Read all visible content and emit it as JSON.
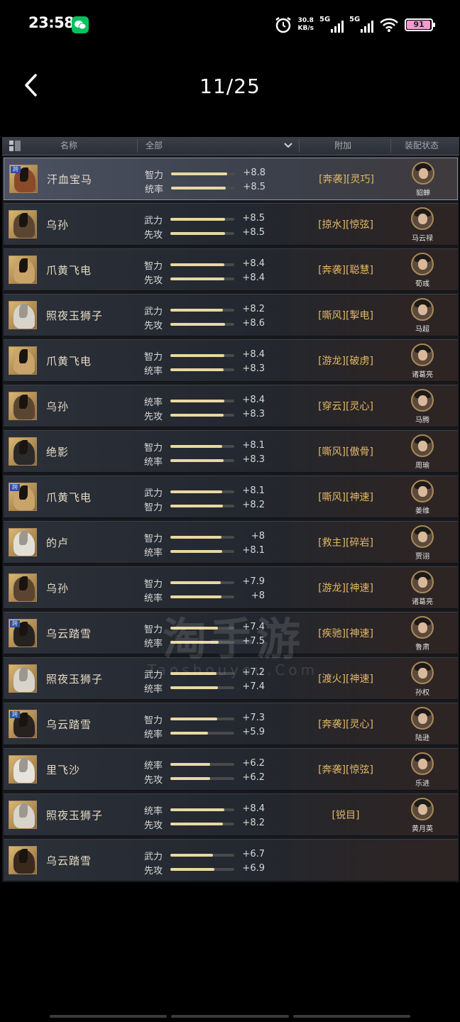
{
  "status": {
    "time": "23:58",
    "speed_value": "30.8",
    "speed_unit": "KB/s",
    "sim1": "5G",
    "sim2": "5G",
    "battery": "91"
  },
  "nav": {
    "title": "11/25"
  },
  "header": {
    "name": "名称",
    "filter": "全部",
    "attach": "附加",
    "equip": "装配状态"
  },
  "rows": [
    {
      "name": "汗血宝马",
      "kua": "跨",
      "s1": "智力",
      "v1": "+8.8",
      "f1": 0.88,
      "s2": "统率",
      "v2": "+8.5",
      "f2": 0.85,
      "attach": "[奔袭][灵巧]",
      "general": "貂蝉",
      "coat": "#8a4a2a"
    },
    {
      "name": "乌孙",
      "kua": "",
      "s1": "武力",
      "v1": "+8.5",
      "f1": 0.85,
      "s2": "先攻",
      "v2": "+8.5",
      "f2": 0.85,
      "attach": "[掠水][惊弦]",
      "general": "马云禄",
      "coat": "#5a4630"
    },
    {
      "name": "爪黄飞电",
      "kua": "",
      "s1": "智力",
      "v1": "+8.4",
      "f1": 0.84,
      "s2": "先攻",
      "v2": "+8.4",
      "f2": 0.84,
      "attach": "[奔袭][聪慧]",
      "general": "荀彧",
      "coat": "#c8a36a"
    },
    {
      "name": "照夜玉狮子",
      "kua": "",
      "s1": "武力",
      "v1": "+8.2",
      "f1": 0.82,
      "s2": "先攻",
      "v2": "+8.6",
      "f2": 0.86,
      "attach": "[嘶风][掣电]",
      "general": "马超",
      "coat": "#d8d4cc"
    },
    {
      "name": "爪黄飞电",
      "kua": "",
      "s1": "智力",
      "v1": "+8.4",
      "f1": 0.84,
      "s2": "统率",
      "v2": "+8.3",
      "f2": 0.83,
      "attach": "[游龙][破虏]",
      "general": "诸葛亮",
      "coat": "#c8a36a"
    },
    {
      "name": "乌孙",
      "kua": "",
      "s1": "统率",
      "v1": "+8.4",
      "f1": 0.84,
      "s2": "先攻",
      "v2": "+8.3",
      "f2": 0.83,
      "attach": "[穿云][灵心]",
      "general": "马腾",
      "coat": "#5a4630"
    },
    {
      "name": "绝影",
      "kua": "",
      "s1": "智力",
      "v1": "+8.1",
      "f1": 0.81,
      "s2": "统率",
      "v2": "+8.3",
      "f2": 0.83,
      "attach": "[嘶风][傲骨]",
      "general": "周瑜",
      "coat": "#2b2a2a"
    },
    {
      "name": "爪黄飞电",
      "kua": "跨",
      "s1": "武力",
      "v1": "+8.1",
      "f1": 0.81,
      "s2": "智力",
      "v2": "+8.2",
      "f2": 0.82,
      "attach": "[嘶风][神速]",
      "general": "姜维",
      "coat": "#c8a36a"
    },
    {
      "name": "的卢",
      "kua": "",
      "s1": "智力",
      "v1": "+8",
      "f1": 0.8,
      "s2": "统率",
      "v2": "+8.1",
      "f2": 0.81,
      "attach": "[救主][碎岩]",
      "general": "贾诩",
      "coat": "#e2dfd6"
    },
    {
      "name": "乌孙",
      "kua": "",
      "s1": "智力",
      "v1": "+7.9",
      "f1": 0.79,
      "s2": "统率",
      "v2": "+8",
      "f2": 0.8,
      "attach": "[游龙][神速]",
      "general": "诸葛亮",
      "coat": "#5a4630"
    },
    {
      "name": "乌云踏雪",
      "kua": "跨",
      "s1": "智力",
      "v1": "+7.4",
      "f1": 0.74,
      "s2": "统率",
      "v2": "+7.5",
      "f2": 0.75,
      "attach": "[疾驰][神速]",
      "general": "鲁肃",
      "coat": "#26221f"
    },
    {
      "name": "照夜玉狮子",
      "kua": "",
      "s1": "武力",
      "v1": "+7.2",
      "f1": 0.72,
      "s2": "统率",
      "v2": "+7.4",
      "f2": 0.74,
      "attach": "[渡火][神速]",
      "general": "孙权",
      "coat": "#d8d4cc"
    },
    {
      "name": "乌云踏雪",
      "kua": "跨",
      "s1": "智力",
      "v1": "+7.3",
      "f1": 0.73,
      "s2": "统率",
      "v2": "+5.9",
      "f2": 0.59,
      "attach": "[奔袭][灵心]",
      "general": "陆逊",
      "coat": "#26221f"
    },
    {
      "name": "里飞沙",
      "kua": "",
      "s1": "统率",
      "v1": "+6.2",
      "f1": 0.62,
      "s2": "先攻",
      "v2": "+6.2",
      "f2": 0.62,
      "attach": "[奔袭][惊弦]",
      "general": "乐进",
      "coat": "#e6e3dc"
    },
    {
      "name": "照夜玉狮子",
      "kua": "",
      "s1": "统率",
      "v1": "+8.4",
      "f1": 0.84,
      "s2": "先攻",
      "v2": "+8.2",
      "f2": 0.82,
      "attach": "[锐目]",
      "general": "黄月英",
      "coat": "#d8d4cc"
    },
    {
      "name": "乌云踏雪",
      "kua": "",
      "s1": "武力",
      "v1": "+6.7",
      "f1": 0.67,
      "s2": "先攻",
      "v2": "+6.9",
      "f2": 0.69,
      "attach": "",
      "general": "",
      "coat": "#3a2a1e"
    }
  ],
  "watermark": {
    "main": "淘手游",
    "sub": "Taoshouyou.Com"
  }
}
